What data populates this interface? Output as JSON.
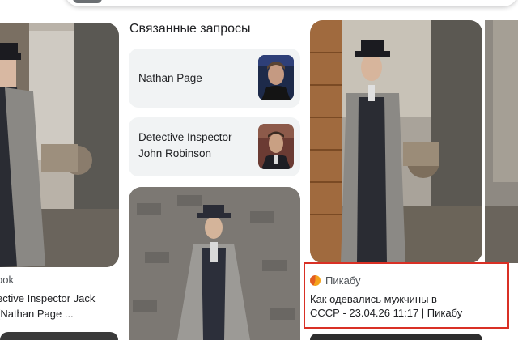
{
  "left_result": {
    "source": "ook",
    "title_line1": "ective Inspector Jack",
    "title_line2": "(Nathan Page ..."
  },
  "related_searches": {
    "heading": "Связанные запросы",
    "items": [
      {
        "label": "Nathan Page"
      },
      {
        "label_line1": "Detective Inspector",
        "label_line2": "John Robinson"
      }
    ]
  },
  "right_result": {
    "source": "Пикабу",
    "title_line1": "Как одевались мужчины в",
    "title_line2": "СССР - 23.04.26 11:17 | Пикабу"
  },
  "colors": {
    "highlight_border": "#d93025",
    "card_background": "#f1f3f4"
  }
}
